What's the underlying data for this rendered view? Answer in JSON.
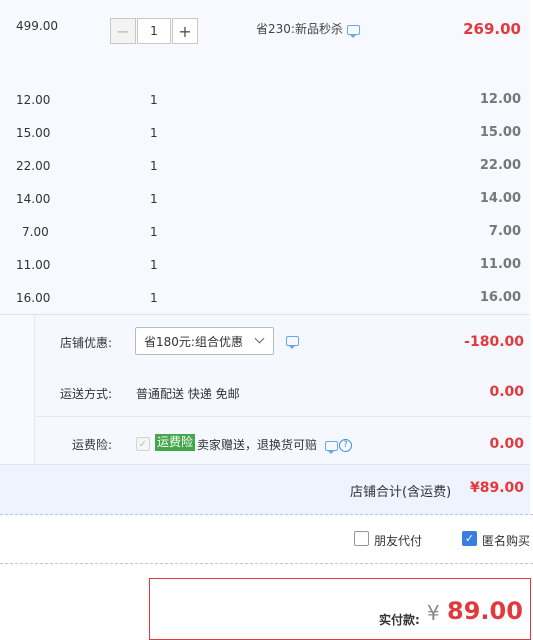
{
  "items": {
    "main": {
      "price": "499.00",
      "quantity": "1",
      "minus": "−",
      "plus": "+",
      "promo": "省230:新品秒杀",
      "total": "269.00"
    },
    "rows": [
      {
        "price": "12.00",
        "qty": "1",
        "total": "12.00"
      },
      {
        "price": "15.00",
        "qty": "1",
        "total": "15.00"
      },
      {
        "price": "22.00",
        "qty": "1",
        "total": "22.00"
      },
      {
        "price": "14.00",
        "qty": "1",
        "total": "14.00"
      },
      {
        "price": "7.00",
        "qty": "1",
        "total": "7.00"
      },
      {
        "price": "11.00",
        "qty": "1",
        "total": "11.00"
      },
      {
        "price": "16.00",
        "qty": "1",
        "total": "16.00"
      }
    ]
  },
  "shop": {
    "discount_label": "店铺优惠:",
    "discount_select": "省180元:组合优惠",
    "discount_amount": "-180.00",
    "shipping_label": "运送方式:",
    "shipping_value": "普通配送 快递 免邮",
    "shipping_amount": "0.00",
    "insurance_label": "运费险:",
    "insurance_tag": "运费险",
    "insurance_desc": "卖家赠送，退换货可赔",
    "insurance_amount": "0.00",
    "total_label": "店铺合计(含运费)",
    "total_amount": "¥89.00"
  },
  "options": {
    "friend_pay": "朋友代付",
    "anonymous": "匿名购买"
  },
  "payment": {
    "label": "实付款:",
    "currency": "¥",
    "amount": "89.00"
  },
  "colors": {
    "accent_red": "#e4393c",
    "link_blue": "#3b7de0",
    "tag_green": "#46a64a"
  }
}
